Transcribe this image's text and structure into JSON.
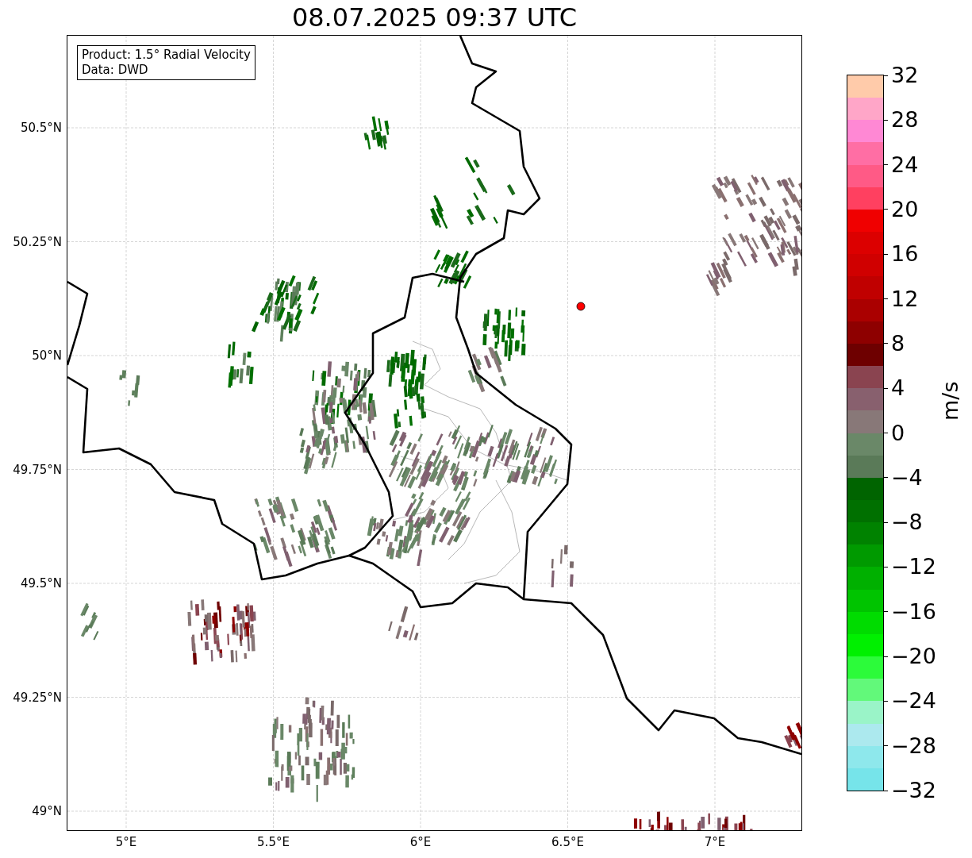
{
  "title": "08.07.2025 09:37 UTC",
  "info_box": [
    "Product: 1.5° Radial Velocity",
    "Data: DWD"
  ],
  "map": {
    "y_ticks": [
      "50.5°N",
      "50.25°N",
      "50°N",
      "49.75°N",
      "49.5°N",
      "49.25°N",
      "49°N"
    ],
    "x_ticks": [
      "5°E",
      "5.5°E",
      "6°E",
      "6.5°E",
      "7°E"
    ]
  },
  "colorbar": {
    "label": "m/s",
    "ticks": [
      "32",
      "28",
      "24",
      "20",
      "16",
      "12",
      "8",
      "4",
      "0",
      "−4",
      "−8",
      "−12",
      "−16",
      "−20",
      "−24",
      "−28",
      "−32"
    ],
    "bands": [
      {
        "color": "#ffcbaa"
      },
      {
        "color": "#ffa6c8"
      },
      {
        "color": "#ff88d4"
      },
      {
        "color": "#ff6ea4"
      },
      {
        "color": "#ff5a86"
      },
      {
        "color": "#ff4060"
      },
      {
        "color": "#f00000"
      },
      {
        "color": "#dc0000"
      },
      {
        "color": "#d00000"
      },
      {
        "color": "#c00000"
      },
      {
        "color": "#aa0000"
      },
      {
        "color": "#8e0000"
      },
      {
        "color": "#6e0000"
      },
      {
        "color": "#8a4450"
      },
      {
        "color": "#88606e"
      },
      {
        "color": "#887878"
      },
      {
        "color": "#6a8868"
      },
      {
        "color": "#5a7a58"
      },
      {
        "color": "#006400"
      },
      {
        "color": "#007000"
      },
      {
        "color": "#008200"
      },
      {
        "color": "#009a00"
      },
      {
        "color": "#00b000"
      },
      {
        "color": "#00c400"
      },
      {
        "color": "#00dc00"
      },
      {
        "color": "#00f000"
      },
      {
        "color": "#2cfb3a"
      },
      {
        "color": "#62f97a"
      },
      {
        "color": "#9af4c8"
      },
      {
        "color": "#ace9ee"
      },
      {
        "color": "#8ee8ec"
      },
      {
        "color": "#76e4ea"
      }
    ]
  }
}
